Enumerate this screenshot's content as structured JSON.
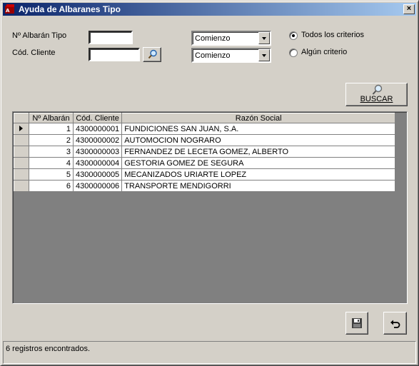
{
  "window": {
    "title": "Ayuda de Albaranes Tipo"
  },
  "filters": {
    "albaran_label": "Nº Albarán Tipo",
    "albaran_value": "",
    "cliente_label": "Cód. Cliente",
    "cliente_value": "",
    "albaran_match": "Comienzo",
    "cliente_match": "Comienzo",
    "radio_all": "Todos los criterios",
    "radio_any": "Algún criterio",
    "selected": "all"
  },
  "buttons": {
    "search_label": "BUSCAR"
  },
  "grid": {
    "headers": [
      "Nº Albarán",
      "Cód. Cliente",
      "Razón Social"
    ],
    "rows": [
      {
        "num": "1",
        "code": "4300000001",
        "name": "FUNDICIONES SAN JUAN, S.A."
      },
      {
        "num": "2",
        "code": "4300000002",
        "name": "AUTOMOCION NOGRARO"
      },
      {
        "num": "3",
        "code": "4300000003",
        "name": "FERNANDEZ DE LECETA GOMEZ, ALBERTO"
      },
      {
        "num": "4",
        "code": "4300000004",
        "name": "GESTORIA GOMEZ DE SEGURA"
      },
      {
        "num": "5",
        "code": "4300000005",
        "name": "MECANIZADOS URIARTE LOPEZ"
      },
      {
        "num": "6",
        "code": "4300000006",
        "name": "TRANSPORTE MENDIGORRI"
      }
    ]
  },
  "status": {
    "text": "6 registros encontrados."
  },
  "colors": {
    "title_start": "#0a246a",
    "title_end": "#a6caf0",
    "face": "#d4d0c8"
  },
  "icons": {
    "search": "magnifier-icon",
    "save": "floppy-disk-icon",
    "undo": "undo-arrow-icon"
  }
}
